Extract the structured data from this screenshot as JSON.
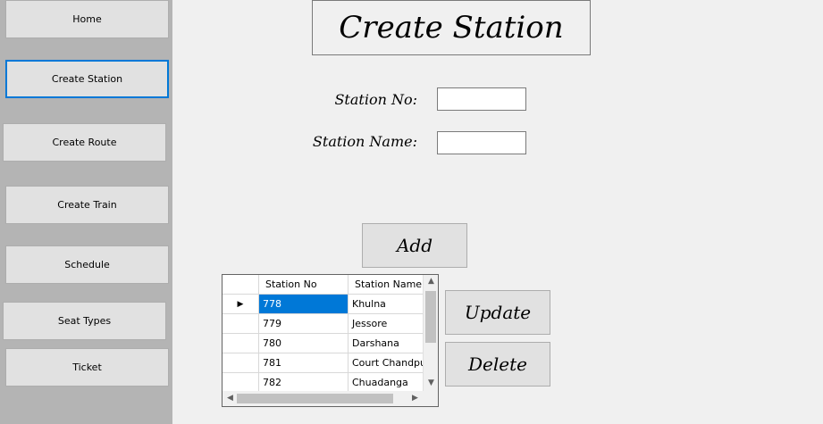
{
  "sidebar": {
    "items": [
      {
        "label": "Home"
      },
      {
        "label": "Create Station"
      },
      {
        "label": "Create Route"
      },
      {
        "label": "Create Train"
      },
      {
        "label": "Schedule"
      },
      {
        "label": "Seat Types"
      },
      {
        "label": "Ticket"
      }
    ]
  },
  "main": {
    "title": "Create Station",
    "form": {
      "station_no_label": "Station No:",
      "station_no_value": "",
      "station_name_label": "Station Name:",
      "station_name_value": ""
    },
    "add_label": "Add",
    "update_label": "Update",
    "delete_label": "Delete"
  },
  "grid": {
    "columns": [
      "Station No",
      "Station Name"
    ],
    "rows": [
      {
        "no": "778",
        "name": "Khulna",
        "selected": true
      },
      {
        "no": "779",
        "name": "Jessore"
      },
      {
        "no": "780",
        "name": "Darshana"
      },
      {
        "no": "781",
        "name": "Court Chandpur"
      },
      {
        "no": "782",
        "name": "Chuadanga"
      }
    ],
    "current_row_marker": "▶"
  },
  "colors": {
    "sidebar_bg": "#b4b4b4",
    "button_bg": "#e1e1e1",
    "selection": "#0078d7",
    "page_bg": "#f0f0f0"
  }
}
